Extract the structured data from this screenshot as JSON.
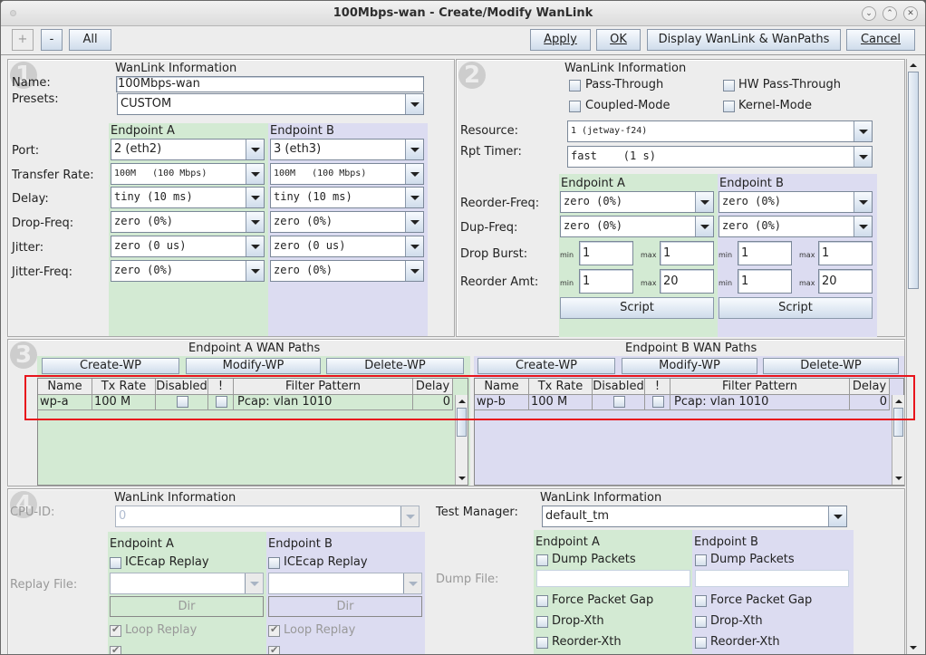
{
  "window": {
    "title": "100Mbps-wan - Create/Modify WanLink",
    "controls": {
      "minimize": "⌄",
      "maximize": "⌃",
      "close": "✕"
    }
  },
  "toolbar": {
    "plus_label": "+",
    "minus_label": "-",
    "all_label": "All",
    "apply_label": "Apply",
    "ok_label": "OK",
    "display_label": "Display WanLink & WanPaths",
    "cancel_label": "Cancel"
  },
  "panel1": {
    "number": "1",
    "header": "WanLink Information",
    "name_label": "Name:",
    "name_value": "100Mbps-wan",
    "presets_label": "Presets:",
    "presets_value": "CUSTOM",
    "endpoint_a": "Endpoint A",
    "endpoint_b": "Endpoint B",
    "rows": [
      {
        "label": "Port:",
        "a": "2 (eth2)",
        "b": "3 (eth3)"
      },
      {
        "label": "Transfer Rate:",
        "a": "100M   (100 Mbps)",
        "b": "100M   (100 Mbps)"
      },
      {
        "label": "Delay:",
        "a": "tiny (10 ms)",
        "b": "tiny (10 ms)"
      },
      {
        "label": "Drop-Freq:",
        "a": "zero (0%)",
        "b": "zero (0%)"
      },
      {
        "label": "Jitter:",
        "a": "zero (0 us)",
        "b": "zero (0 us)"
      },
      {
        "label": "Jitter-Freq:",
        "a": "zero (0%)",
        "b": "zero (0%)"
      }
    ]
  },
  "panel2": {
    "number": "2",
    "header": "WanLink Information",
    "checkboxes": {
      "pass_through": "Pass-Through",
      "hw_pass_through": "HW Pass-Through",
      "coupled_mode": "Coupled-Mode",
      "kernel_mode": "Kernel-Mode"
    },
    "resource_label": "Resource:",
    "resource_value": "1 (jetway-f24)",
    "rpt_timer_label": "Rpt Timer:",
    "rpt_timer_value": "fast    (1 s)",
    "endpoint_a": "Endpoint A",
    "endpoint_b": "Endpoint B",
    "reorder_freq_label": "Reorder-Freq:",
    "reorder_freq_a": "zero (0%)",
    "reorder_freq_b": "zero (0%)",
    "dup_freq_label": "Dup-Freq:",
    "dup_freq_a": "zero (0%)",
    "dup_freq_b": "zero (0%)",
    "drop_burst_label": "Drop Burst:",
    "drop_burst": {
      "a_min": "1",
      "a_max": "1",
      "b_min": "1",
      "b_max": "1"
    },
    "reorder_amt_label": "Reorder Amt:",
    "reorder_amt": {
      "a_min": "1",
      "a_max": "20",
      "b_min": "1",
      "b_max": "20"
    },
    "min_label": "min",
    "max_label": "max",
    "script_label": "Script"
  },
  "panel3": {
    "number": "3",
    "a_title": "Endpoint A WAN Paths",
    "b_title": "Endpoint B WAN Paths",
    "create_label": "Create-WP",
    "modify_label": "Modify-WP",
    "delete_label": "Delete-WP",
    "columns": [
      "Name",
      "Tx Rate",
      "Disabled",
      "!",
      "Filter Pattern",
      "Delay"
    ],
    "a_rows": [
      {
        "name": "wp-a",
        "tx_rate": "100 M",
        "disabled": false,
        "not": false,
        "filter": "Pcap: vlan 1010",
        "delay": "0"
      }
    ],
    "b_rows": [
      {
        "name": "wp-b",
        "tx_rate": "100 M",
        "disabled": false,
        "not": false,
        "filter": "Pcap: vlan 1010",
        "delay": "0"
      }
    ]
  },
  "panel4": {
    "number": "4",
    "left_header": "WanLink Information",
    "cpu_id_label": "CPU-ID:",
    "cpu_id_value": "0",
    "endpoint_a": "Endpoint A",
    "endpoint_b": "Endpoint B",
    "icecap_label": "ICEcap Replay",
    "replay_file_label": "Replay File:",
    "dir_label": "Dir",
    "loop_replay_label": "Loop Replay",
    "right_header": "WanLink Information",
    "test_manager_label": "Test Manager:",
    "test_manager_value": "default_tm",
    "dump_packets_label": "Dump Packets",
    "dump_file_label": "Dump File:",
    "force_gap_label": "Force Packet Gap",
    "drop_xth_label": "Drop-Xth",
    "reorder_xth_label": "Reorder-Xth"
  },
  "colors": {
    "endpoint_a_bg": "#d3ead3",
    "endpoint_b_bg": "#dcdcf1",
    "highlight_box": "#e8141c"
  }
}
